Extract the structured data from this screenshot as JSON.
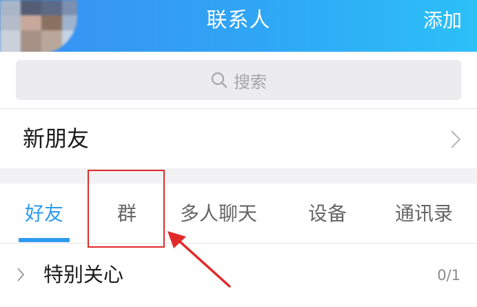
{
  "header": {
    "title": "联系人",
    "add_label": "添加"
  },
  "search": {
    "placeholder": "搜索",
    "icon": "search-icon"
  },
  "new_friends": {
    "label": "新朋友",
    "icon": "chevron-right-icon"
  },
  "tabs": [
    {
      "label": "好友",
      "active": true
    },
    {
      "label": "群",
      "active": false
    },
    {
      "label": "多人聊天",
      "active": false
    },
    {
      "label": "设备",
      "active": false
    },
    {
      "label": "通讯录",
      "active": false
    }
  ],
  "groups": [
    {
      "label": "特别关心",
      "count": "0/1",
      "icon": "chevron-right-icon"
    }
  ],
  "colors": {
    "header_start": "#3a8ff2",
    "header_end": "#2cc0f8",
    "accent": "#2d9bf0",
    "annotation": "#e12a2a"
  }
}
